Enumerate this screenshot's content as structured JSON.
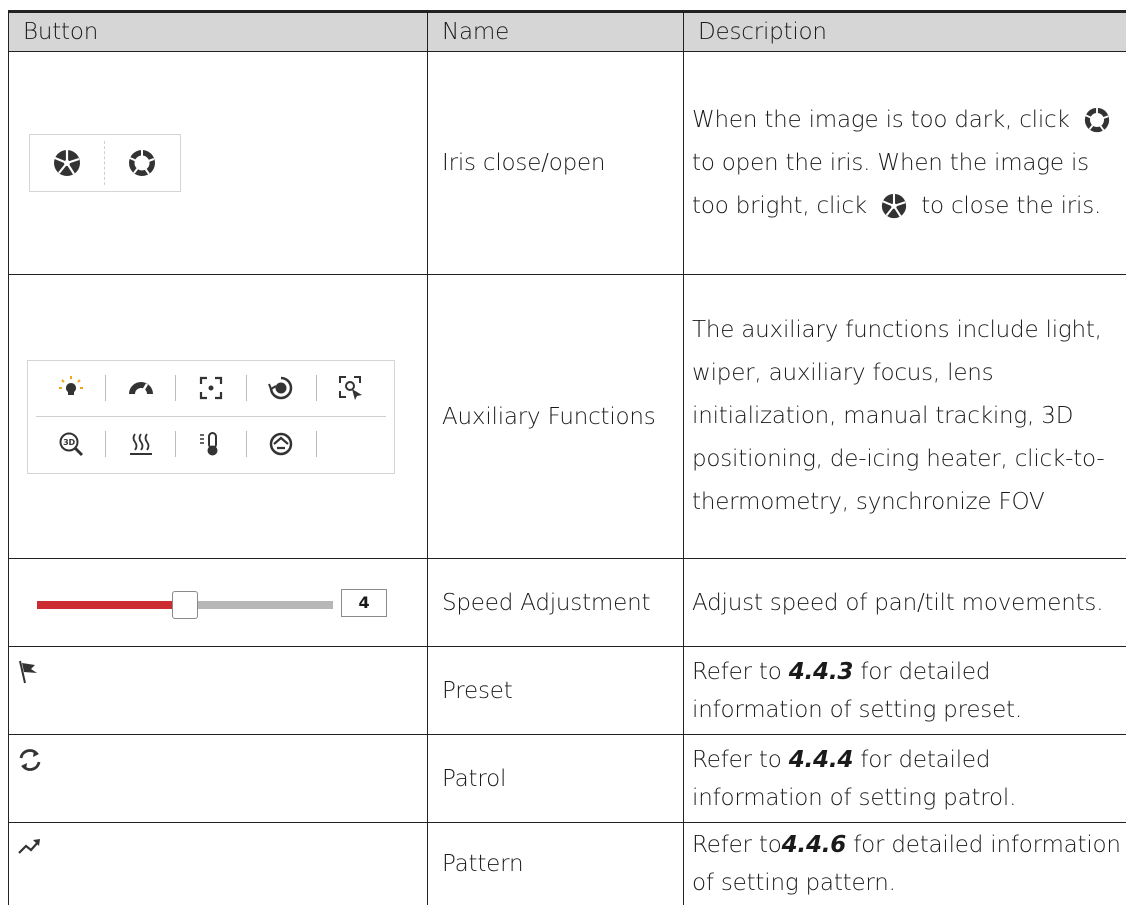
{
  "headers": {
    "button": "Button",
    "name": "Name",
    "description": "Description"
  },
  "rows": {
    "iris": {
      "name": "Iris close/open",
      "desc_1": "When the image is too dark, click",
      "desc_2": "to open the iris. When the image is too bright, click",
      "desc_3": "to close the iris."
    },
    "auxiliary": {
      "name": "Auxiliary Functions",
      "desc": "The auxiliary functions include light, wiper, auxiliary focus, lens initialization, manual tracking, 3D positioning, de-icing heater, click-to-thermometry, synchronize FOV"
    },
    "speed": {
      "name": "Speed Adjustment",
      "value": "4",
      "slider_fraction": 0.5,
      "desc": "Adjust speed of pan/tilt movements."
    },
    "preset": {
      "name": "Preset",
      "desc_pre": "Refer to ",
      "ref": "4.4.3",
      "desc_post": " for detailed information of setting preset."
    },
    "patrol": {
      "name": "Patrol",
      "desc_pre": "Refer to ",
      "ref": "4.4.4",
      "desc_post": " for detailed information of setting patrol."
    },
    "pattern": {
      "name": "Pattern",
      "desc_pre": "Refer to",
      "ref": "4.4.6",
      "desc_post": " for detailed information of setting pattern."
    }
  },
  "icons": {
    "iris_close": "iris-close-icon",
    "iris_open": "iris-open-icon",
    "aux": [
      "light-icon",
      "wiper-icon",
      "auxiliary-focus-icon",
      "lens-initialization-icon",
      "manual-tracking-icon",
      "3d-positioning-icon",
      "de-icing-heater-icon",
      "click-to-thermometry-icon",
      "synchronize-fov-icon"
    ],
    "preset": "flag-icon",
    "patrol": "patrol-cycle-icon",
    "pattern": "trend-arrow-icon"
  },
  "colors": {
    "header_bg": "#d6d6d6",
    "slider_active": "#cc2b2f",
    "slider_rest": "#b7b7b7",
    "icon": "#333333"
  }
}
